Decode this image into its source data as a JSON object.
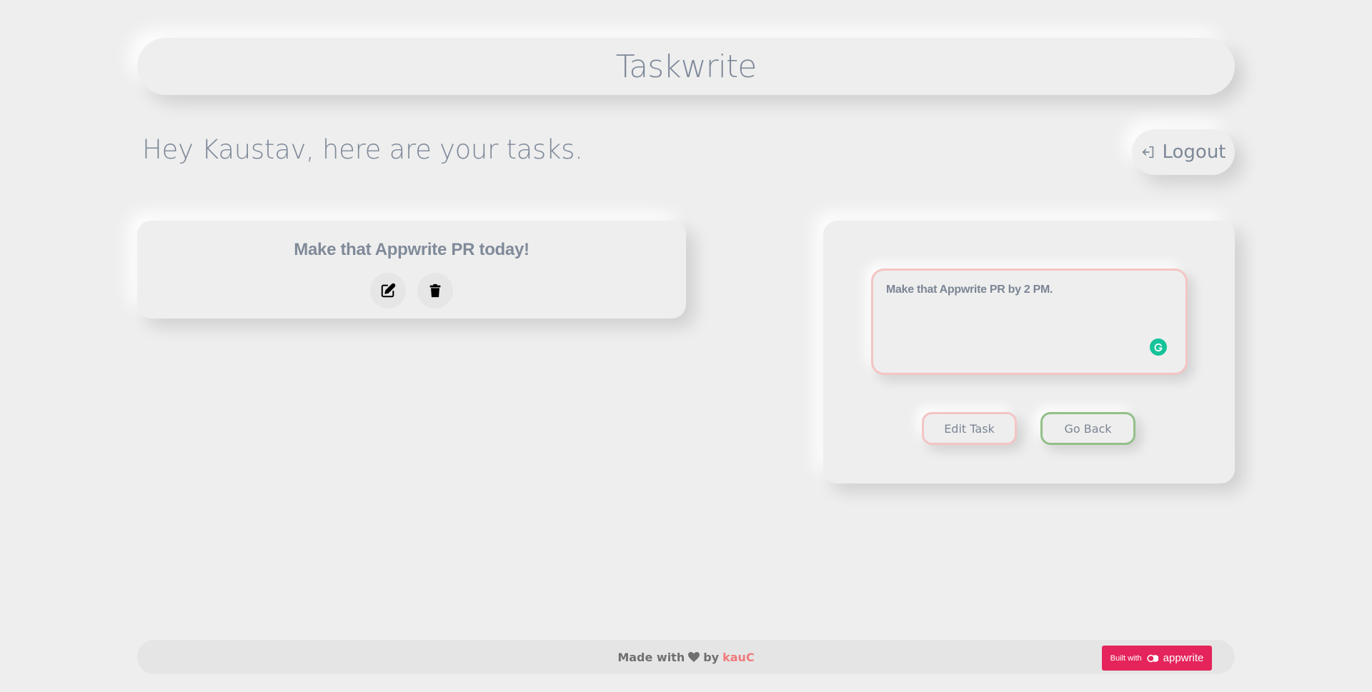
{
  "header": {
    "brand": "Taskwrite"
  },
  "greeting": "Hey Kaustav, here are your tasks.",
  "logout": {
    "label": "Logout",
    "icon": "logout-icon"
  },
  "tasks": [
    {
      "title": "Make that Appwrite PR today!",
      "actions": [
        "edit-icon",
        "trash-icon"
      ]
    }
  ],
  "editor": {
    "value": "Make that Appwrite PR by 2 PM.",
    "edit_label": "Edit Task",
    "back_label": "Go Back"
  },
  "footer": {
    "made_with": "Made with",
    "by": "by",
    "author": "kauC",
    "badge_prefix": "Built with",
    "badge_name": "appwrite"
  },
  "colors": {
    "background": "#eeeeee",
    "accent_pink": "#f4c4c4",
    "accent_green": "#93c089",
    "author": "#f07a7a",
    "appwrite": "#e4245b",
    "grammarly": "#15c39a"
  }
}
